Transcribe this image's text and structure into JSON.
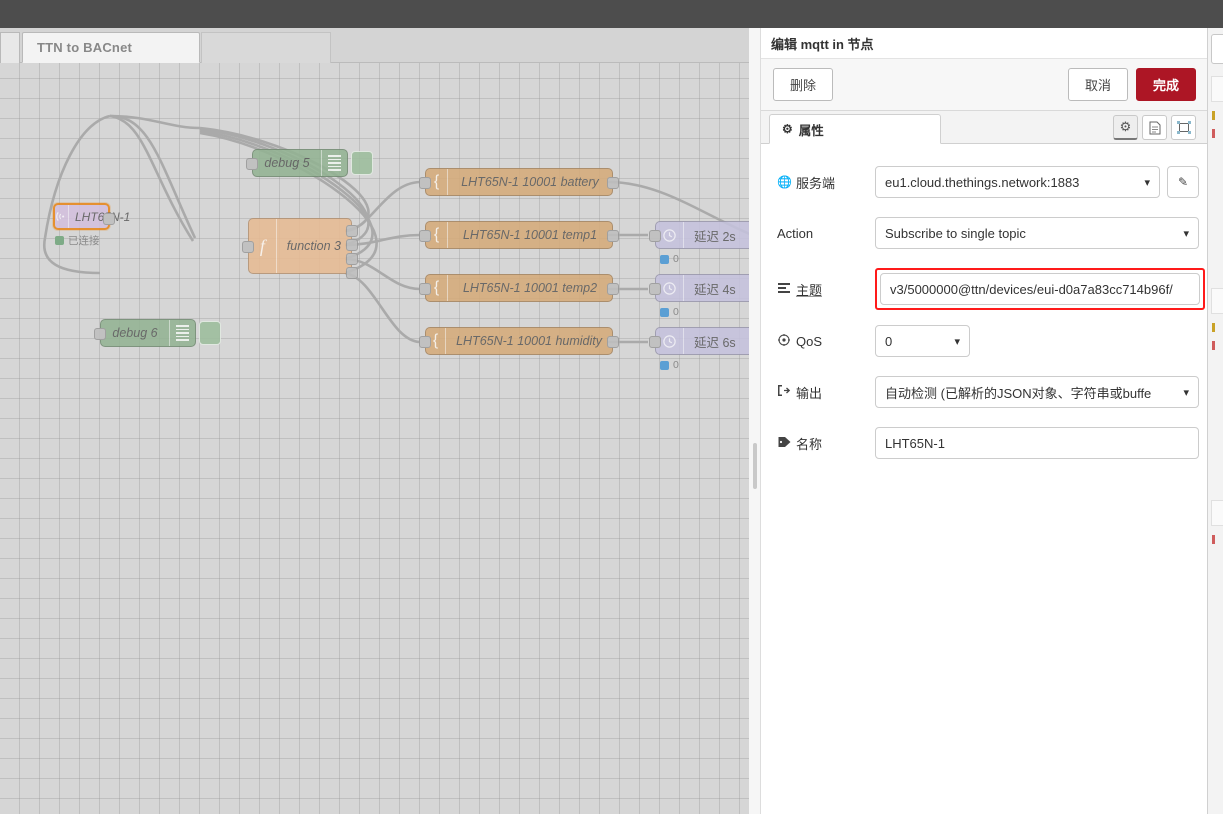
{
  "window": {
    "title_bar_color": "#4d4d4d"
  },
  "workspace": {
    "tabs": [
      {
        "label": "TTN to BACnet",
        "active": true
      }
    ],
    "nodes": [
      {
        "id": "mqtt-in",
        "type": "mqtt in",
        "label": "LHT65N-1",
        "icon": "signal-icon",
        "status": "已连接",
        "status_color": "#7eab87",
        "selected": true,
        "color": "#d3c0dd"
      },
      {
        "id": "debug5",
        "type": "debug",
        "label": "debug 5",
        "icon": "bars-icon",
        "color": "#93b393"
      },
      {
        "id": "debug6",
        "type": "debug",
        "label": "debug 6",
        "icon": "bars-icon",
        "color": "#93b393"
      },
      {
        "id": "function3",
        "type": "function",
        "label": "function 3",
        "icon": "function-icon",
        "color": "#e7bb93"
      },
      {
        "id": "json1",
        "type": "change",
        "label": "LHT65N-1 10001 battery",
        "icon": "brace-icon",
        "color": "#d5ab7a"
      },
      {
        "id": "json2",
        "type": "change",
        "label": "LHT65N-1 10001 temp1",
        "icon": "brace-icon",
        "color": "#d5ab7a"
      },
      {
        "id": "json3",
        "type": "change",
        "label": "LHT65N-1 10001 temp2",
        "icon": "brace-icon",
        "color": "#d5ab7a"
      },
      {
        "id": "json4",
        "type": "change",
        "label": "LHT65N-1 10001 humidity",
        "icon": "brace-icon",
        "color": "#d5ab7a"
      },
      {
        "id": "delay1",
        "type": "delay",
        "label": "延迟 2s",
        "icon": "clock-icon",
        "status": "0",
        "status_color": "#5b9fd4",
        "color": "#c5c2dd"
      },
      {
        "id": "delay2",
        "type": "delay",
        "label": "延迟 4s",
        "icon": "clock-icon",
        "status": "0",
        "status_color": "#5b9fd4",
        "color": "#c5c2dd"
      },
      {
        "id": "delay3",
        "type": "delay",
        "label": "延迟 6s",
        "icon": "clock-icon",
        "status": "0",
        "status_color": "#5b9fd4",
        "color": "#c5c2dd"
      }
    ]
  },
  "dialog": {
    "title": "编辑 mqtt in 节点",
    "buttons": {
      "delete": "删除",
      "cancel": "取消",
      "done": "完成",
      "done_color": "#ad1625"
    },
    "tab": {
      "label": "属性",
      "icon": "gear-icon"
    },
    "icon_buttons": [
      {
        "name": "gear-icon",
        "glyph": "⚙",
        "active": true
      },
      {
        "name": "description-icon",
        "glyph": "὜E",
        "active": false
      },
      {
        "name": "appearance-icon",
        "glyph": "❑",
        "active": false
      }
    ],
    "fields": [
      {
        "key": "server",
        "icon": "globe-icon",
        "label": "服务端",
        "control": "select",
        "value": "eu1.cloud.thethings.network:1883",
        "edit_button": true
      },
      {
        "key": "action",
        "icon": "",
        "label": "Action",
        "control": "select",
        "value": "Subscribe to single topic"
      },
      {
        "key": "topic",
        "icon": "list-icon",
        "label": "主题",
        "control": "input",
        "value": "v3/5000000@ttn/devices/eui-d0a7a83cc714b96f/\u0001",
        "highlight": "#ff1a1a"
      },
      {
        "key": "qos",
        "icon": "target-icon",
        "label": "QoS",
        "control": "select-small",
        "value": "0"
      },
      {
        "key": "output",
        "icon": "export-icon",
        "label": "输出",
        "control": "select",
        "value": "自动检测 (已解析的JSON对象、字符串或buffe"
      },
      {
        "key": "name",
        "icon": "tag-icon",
        "label": "名称",
        "control": "input",
        "value": "LHT65N-1"
      }
    ]
  }
}
